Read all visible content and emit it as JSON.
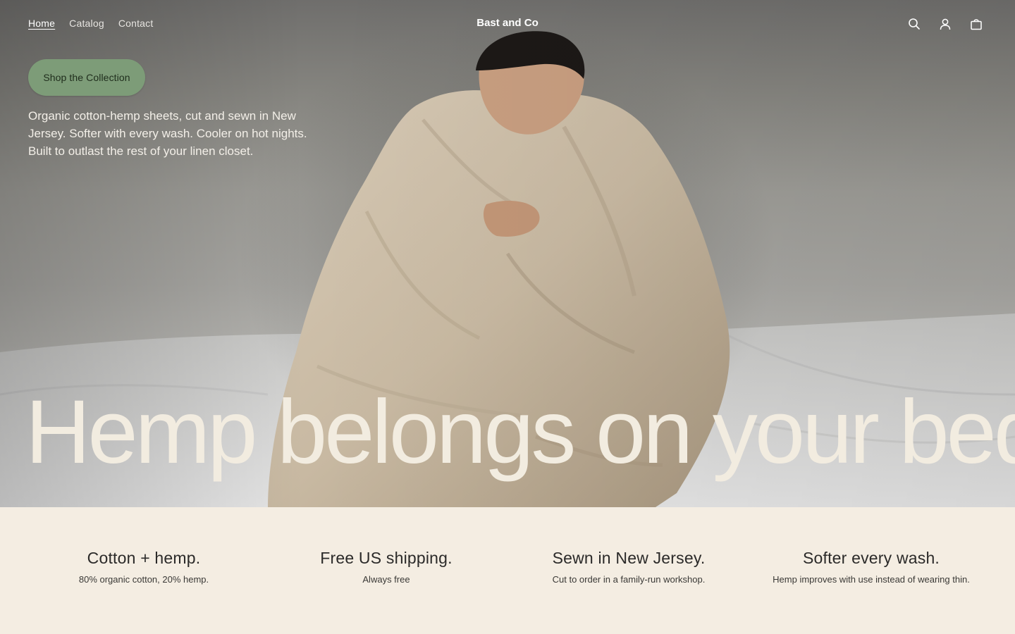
{
  "header": {
    "nav": [
      {
        "label": "Home",
        "active": true
      },
      {
        "label": "Catalog",
        "active": false
      },
      {
        "label": "Contact",
        "active": false
      }
    ],
    "brand": "Bast and Co",
    "icons": [
      "search-icon",
      "account-icon",
      "cart-icon"
    ]
  },
  "hero": {
    "cta_label": "Shop the Collection",
    "intro": "Organic cotton-hemp sheets, cut and sewn in New Jersey. Softer with every wash. Cooler on hot nights. Built to outlast the rest of your linen closet.",
    "headline": "Hemp belongs on your bed."
  },
  "features": [
    {
      "title": "Cotton + hemp.",
      "text": "80% organic cotton, 20% hemp."
    },
    {
      "title": "Free US shipping.",
      "text": "Always free"
    },
    {
      "title": "Sewn in New Jersey.",
      "text": "Cut to order in a family-run workshop."
    },
    {
      "title": "Softer every wash.",
      "text": "Hemp improves with use instead of wearing thin."
    }
  ],
  "colors": {
    "cta_background": "#7d9c78",
    "headline": "#f2ece0",
    "section_background": "#f4ede2",
    "body_text": "#2b2a29"
  }
}
